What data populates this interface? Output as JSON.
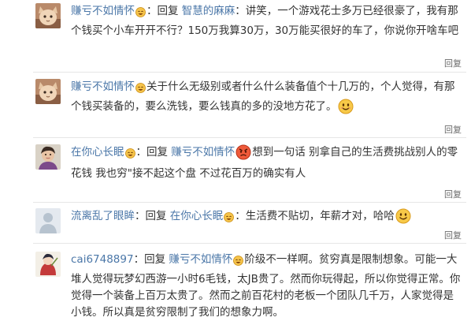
{
  "comments": [
    {
      "user": "赚亏不如情怀",
      "sep": "：",
      "prefix": "回复",
      "target": "智慧的麻麻",
      "body": "：讲笑，一个游戏花士多万已经很豪了，我有那个钱买个小车开开不行？150万我算30万，30万能买很好的车了，你说你开啥车吧",
      "reply_label": "回复"
    },
    {
      "user": "赚亏不如情怀",
      "body": "关于什么无级别或者什么什么装备值个十几万的，个人觉得，有那个钱买装备的，要么洗钱，要么钱真的多的没地方花了。",
      "reply_label": "回复"
    },
    {
      "user": "在你心长眠",
      "sep": "：",
      "prefix": "回复",
      "target": "赚亏不如情怀",
      "body_a": "想到一句话 别拿自己的生活费挑战别人的零花钱 我也穷\"接不起这个盘 不过花百万的确实有人",
      "reply_label": "回复"
    },
    {
      "user": "流离乱了眼眸",
      "sep": "：",
      "prefix": "回复",
      "target": "在你心长眠",
      "body": "：生活费不贴切，年薪才对，哈哈",
      "reply_label": "回复"
    },
    {
      "user": "cai6748897",
      "sep": "：",
      "prefix": "回复",
      "target": "赚亏不如情怀",
      "body": "阶级不一样啊。贫穷真是限制想象。可能一大堆人觉得玩梦幻西游一小时6毛钱，太JB贵了。然而你玩得起，所以你觉得正常。你觉得一个装备上百万太贵了。然而之前百花村的老板一个团队几千万，人家觉得是小钱。所以真是贫穷限制了我们的想象力啊。"
    }
  ],
  "colors": {
    "link": "#4b77a8",
    "text": "#333333",
    "divider": "#e6e6e6"
  },
  "icons": [
    "avatar-cat-icon",
    "avatar-cat-icon",
    "avatar-person-icon",
    "avatar-default-icon",
    "avatar-anime-icon",
    "laugh-emoji-icon",
    "smile-emoji-icon",
    "angry-emoji-icon"
  ]
}
